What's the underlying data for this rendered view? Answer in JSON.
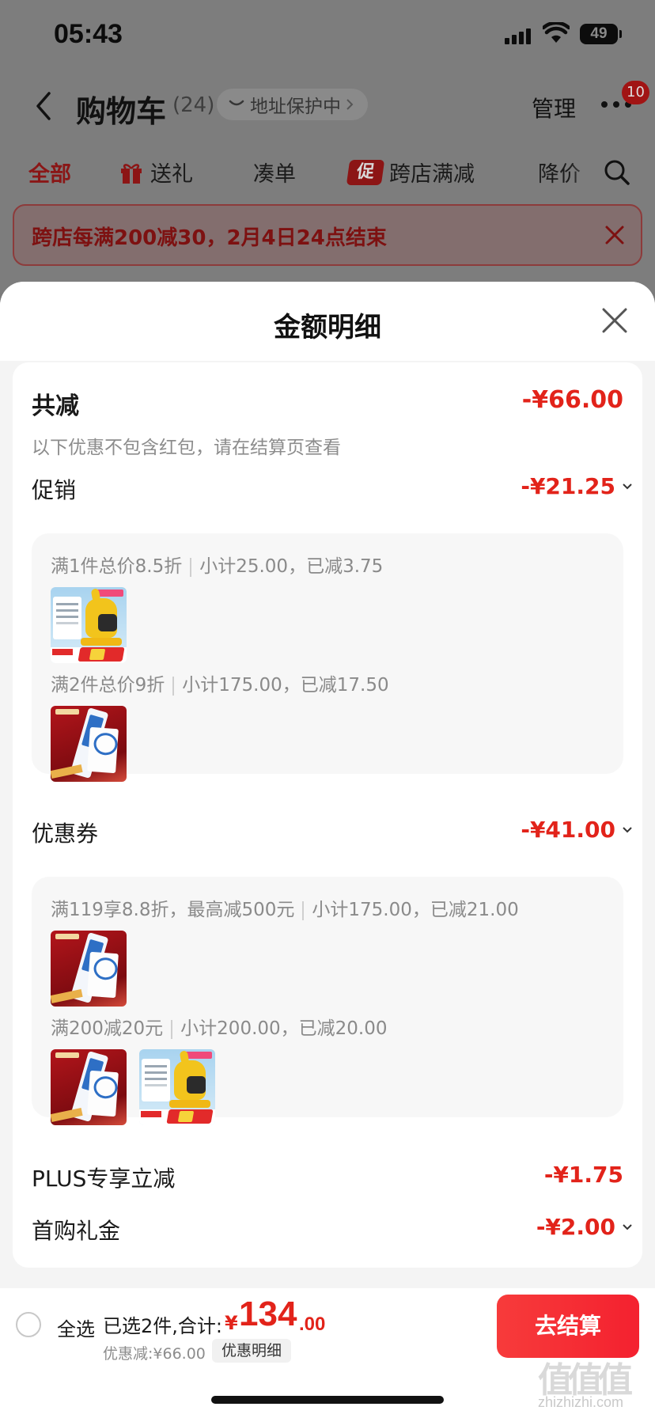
{
  "status_bar": {
    "time": "05:43",
    "battery": "49"
  },
  "nav": {
    "title": "购物车",
    "count": "(24)",
    "address_pill": "地址保护中",
    "manage": "管理",
    "more_badge": "10"
  },
  "tabs": [
    {
      "label": "全部"
    },
    {
      "label": "送礼"
    },
    {
      "label": "凑单"
    },
    {
      "label": "跨店满减",
      "badge": "促"
    },
    {
      "label": "降价"
    }
  ],
  "banner": {
    "text": "跨店每满200减30，2月4日24点结束"
  },
  "sheet": {
    "title": "金额明细",
    "total": {
      "label": "共减",
      "value": "-¥66.00",
      "note": "以下优惠不包含红包，请在结算页查看"
    },
    "promotion": {
      "label": "促销",
      "value": "-¥21.25",
      "rules": [
        {
          "condition": "满1件总价8.5折",
          "summary": "小计25.00，已减3.75"
        },
        {
          "condition": "满2件总价9折",
          "summary": "小计175.00，已减17.50"
        }
      ]
    },
    "coupon": {
      "label": "优惠券",
      "value": "-¥41.00",
      "rules": [
        {
          "condition": "满119享8.8折，最高减500元",
          "summary": "小计175.00，已减21.00"
        },
        {
          "condition": "满200减20元",
          "summary": "小计200.00，已减20.00"
        }
      ]
    },
    "plus": {
      "label": "PLUS专享立减",
      "value": "-¥1.75"
    },
    "first_gift": {
      "label": "首购礼金",
      "value": "-¥2.00"
    }
  },
  "bottom": {
    "select_all": "全选",
    "selected_summary": "已选2件,合计:",
    "price_symbol": "¥",
    "price_int": "134",
    "price_dec": ".00",
    "saved": "优惠减:¥66.00",
    "detail_chip": "优惠明细",
    "checkout": "去结算"
  },
  "watermark": {
    "mark": "值值值",
    "text": "zhizhizhi.com"
  },
  "colors": {
    "accent": "#e2231a",
    "checkout": "#f4212f",
    "overlay": "#7d7d7d"
  }
}
